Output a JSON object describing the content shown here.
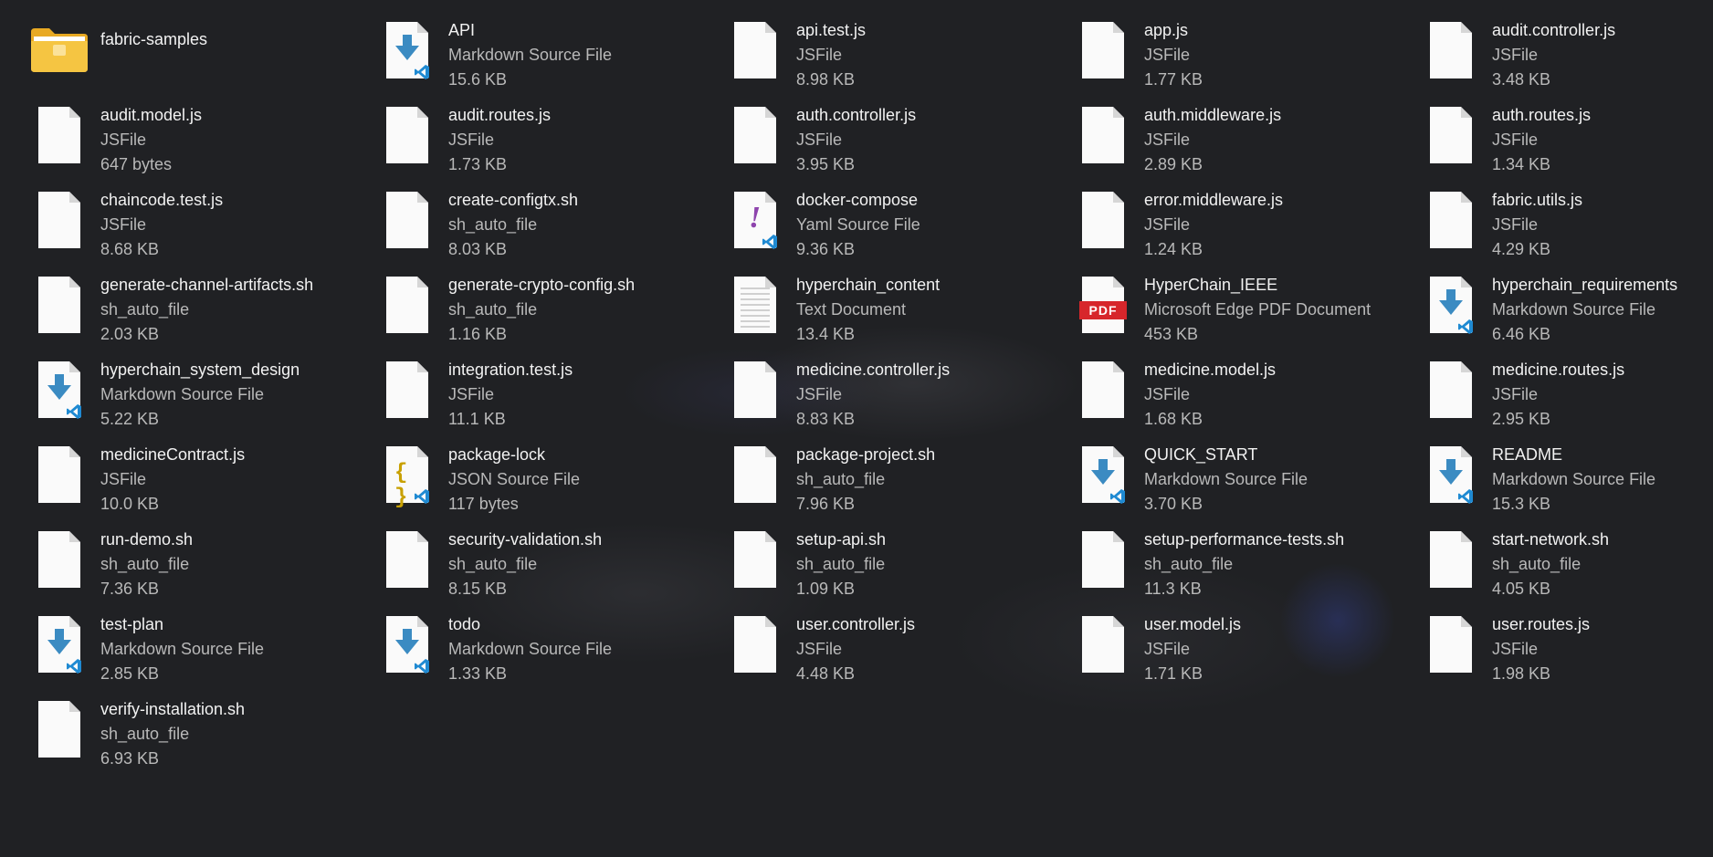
{
  "files": [
    {
      "name": "fabric-samples",
      "type": "",
      "size": "",
      "icon": "folder-icon"
    },
    {
      "name": "API",
      "type": "Markdown Source File",
      "size": "15.6 KB",
      "icon": "markdown-file-icon"
    },
    {
      "name": "api.test.js",
      "type": "JSFile",
      "size": "8.98 KB",
      "icon": "file-icon"
    },
    {
      "name": "app.js",
      "type": "JSFile",
      "size": "1.77 KB",
      "icon": "file-icon"
    },
    {
      "name": "audit.controller.js",
      "type": "JSFile",
      "size": "3.48 KB",
      "icon": "file-icon"
    },
    {
      "name": "audit.model.js",
      "type": "JSFile",
      "size": "647 bytes",
      "icon": "file-icon"
    },
    {
      "name": "audit.routes.js",
      "type": "JSFile",
      "size": "1.73 KB",
      "icon": "file-icon"
    },
    {
      "name": "auth.controller.js",
      "type": "JSFile",
      "size": "3.95 KB",
      "icon": "file-icon"
    },
    {
      "name": "auth.middleware.js",
      "type": "JSFile",
      "size": "2.89 KB",
      "icon": "file-icon"
    },
    {
      "name": "auth.routes.js",
      "type": "JSFile",
      "size": "1.34 KB",
      "icon": "file-icon"
    },
    {
      "name": "chaincode.test.js",
      "type": "JSFile",
      "size": "8.68 KB",
      "icon": "file-icon"
    },
    {
      "name": "create-configtx.sh",
      "type": "sh_auto_file",
      "size": "8.03 KB",
      "icon": "file-icon"
    },
    {
      "name": "docker-compose",
      "type": "Yaml Source File",
      "size": "9.36 KB",
      "icon": "yaml-file-icon"
    },
    {
      "name": "error.middleware.js",
      "type": "JSFile",
      "size": "1.24 KB",
      "icon": "file-icon"
    },
    {
      "name": "fabric.utils.js",
      "type": "JSFile",
      "size": "4.29 KB",
      "icon": "file-icon"
    },
    {
      "name": "generate-channel-artifacts.sh",
      "type": "sh_auto_file",
      "size": "2.03 KB",
      "icon": "file-icon"
    },
    {
      "name": "generate-crypto-config.sh",
      "type": "sh_auto_file",
      "size": "1.16 KB",
      "icon": "file-icon"
    },
    {
      "name": "hyperchain_content",
      "type": "Text Document",
      "size": "13.4 KB",
      "icon": "text-file-icon"
    },
    {
      "name": "HyperChain_IEEE",
      "type": "Microsoft Edge PDF Document",
      "size": "453 KB",
      "icon": "pdf-file-icon"
    },
    {
      "name": "hyperchain_requirements",
      "type": "Markdown Source File",
      "size": "6.46 KB",
      "icon": "markdown-file-icon"
    },
    {
      "name": "hyperchain_system_design",
      "type": "Markdown Source File",
      "size": "5.22 KB",
      "icon": "markdown-file-icon"
    },
    {
      "name": "integration.test.js",
      "type": "JSFile",
      "size": "11.1 KB",
      "icon": "file-icon"
    },
    {
      "name": "medicine.controller.js",
      "type": "JSFile",
      "size": "8.83 KB",
      "icon": "file-icon"
    },
    {
      "name": "medicine.model.js",
      "type": "JSFile",
      "size": "1.68 KB",
      "icon": "file-icon"
    },
    {
      "name": "medicine.routes.js",
      "type": "JSFile",
      "size": "2.95 KB",
      "icon": "file-icon"
    },
    {
      "name": "medicineContract.js",
      "type": "JSFile",
      "size": "10.0 KB",
      "icon": "file-icon"
    },
    {
      "name": "package-lock",
      "type": "JSON Source File",
      "size": "117 bytes",
      "icon": "json-file-icon"
    },
    {
      "name": "package-project.sh",
      "type": "sh_auto_file",
      "size": "7.96 KB",
      "icon": "file-icon"
    },
    {
      "name": "QUICK_START",
      "type": "Markdown Source File",
      "size": "3.70 KB",
      "icon": "markdown-file-icon"
    },
    {
      "name": "README",
      "type": "Markdown Source File",
      "size": "15.3 KB",
      "icon": "markdown-file-icon"
    },
    {
      "name": "run-demo.sh",
      "type": "sh_auto_file",
      "size": "7.36 KB",
      "icon": "file-icon"
    },
    {
      "name": "security-validation.sh",
      "type": "sh_auto_file",
      "size": "8.15 KB",
      "icon": "file-icon"
    },
    {
      "name": "setup-api.sh",
      "type": "sh_auto_file",
      "size": "1.09 KB",
      "icon": "file-icon"
    },
    {
      "name": "setup-performance-tests.sh",
      "type": "sh_auto_file",
      "size": "11.3 KB",
      "icon": "file-icon"
    },
    {
      "name": "start-network.sh",
      "type": "sh_auto_file",
      "size": "4.05 KB",
      "icon": "file-icon"
    },
    {
      "name": "test-plan",
      "type": "Markdown Source File",
      "size": "2.85 KB",
      "icon": "markdown-file-icon"
    },
    {
      "name": "todo",
      "type": "Markdown Source File",
      "size": "1.33 KB",
      "icon": "markdown-file-icon"
    },
    {
      "name": "user.controller.js",
      "type": "JSFile",
      "size": "4.48 KB",
      "icon": "file-icon"
    },
    {
      "name": "user.model.js",
      "type": "JSFile",
      "size": "1.71 KB",
      "icon": "file-icon"
    },
    {
      "name": "user.routes.js",
      "type": "JSFile",
      "size": "1.98 KB",
      "icon": "file-icon"
    },
    {
      "name": "verify-installation.sh",
      "type": "sh_auto_file",
      "size": "6.93 KB",
      "icon": "file-icon"
    }
  ],
  "pdf_label": "PDF",
  "colors": {
    "background": "#202124",
    "markdown_arrow": "#3b8bc2",
    "vscode_blue": "#1f8ad2",
    "pdf_red": "#d7262b",
    "yaml_purple": "#8e44ad",
    "json_yellow": "#c8a000",
    "folder_yellow": "#f5c542"
  }
}
